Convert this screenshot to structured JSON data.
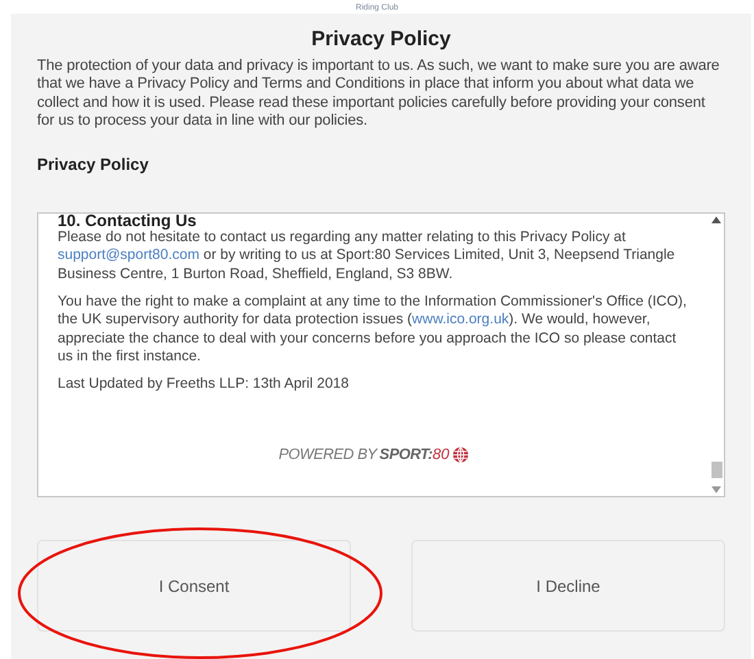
{
  "header": {
    "club_name": "Riding Club"
  },
  "dialog": {
    "title": "Privacy Policy",
    "intro": "The protection of your data and privacy is important to us. As such, we want to make sure you are aware that we have a Privacy Policy and Terms and Conditions in place that inform you about what data we collect and how it is used. Please read these important policies carefully before providing your consent for us to process your data in line with our policies.",
    "section_heading": "Privacy Policy",
    "policy_box": {
      "heading": "10. Contacting Us",
      "paragraphs": [
        [
          {
            "kind": "text",
            "text": "Please do not hesitate to contact us regarding any matter relating to this Privacy Policy at "
          },
          {
            "kind": "link",
            "text": "support@sport80.com"
          },
          {
            "kind": "text",
            "text": " or by writing to us at Sport:80 Services Limited, Unit 3, Neepsend Triangle Business Centre, 1 Burton Road, Sheffield, England, S3 8BW."
          }
        ],
        [
          {
            "kind": "text",
            "text": "You have the right to make a complaint at any time to the Information Commissioner's Office (ICO), the UK supervisory authority for data protection issues ("
          },
          {
            "kind": "link",
            "text": "www.ico.org.uk"
          },
          {
            "kind": "text",
            "text": "). We would, however, appreciate the chance to deal with your concerns before you approach the ICO so please contact us in the first instance."
          }
        ],
        [
          {
            "kind": "text",
            "text": "Last Updated by Freeths LLP: 13th April 2018"
          }
        ]
      ],
      "powered_by": "POWERED BY",
      "brand_name": "SPORT:",
      "brand_number": "80"
    },
    "buttons": [
      "I Consent",
      "I Decline"
    ]
  }
}
